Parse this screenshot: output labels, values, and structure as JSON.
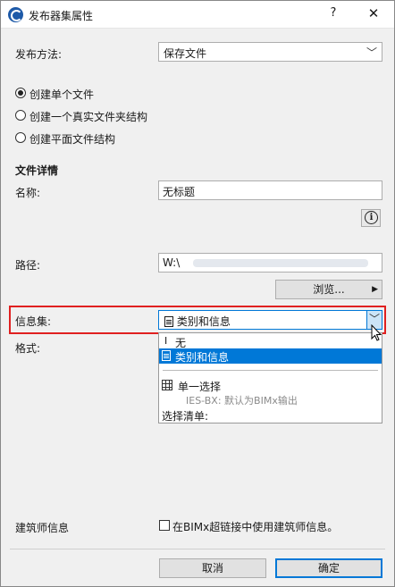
{
  "window": {
    "title": "发布器集属性",
    "help": "?",
    "close": "✕"
  },
  "publish_method": {
    "label": "发布方法:",
    "value": "保存文件"
  },
  "radios": [
    {
      "label": "创建单个文件",
      "checked": true
    },
    {
      "label": "创建一个真实文件夹结构",
      "checked": false
    },
    {
      "label": "创建平面文件结构",
      "checked": false
    }
  ],
  "file_details": {
    "heading": "文件详情",
    "name_label": "名称:",
    "name_value": "无标题",
    "path_label": "路径:",
    "path_value": "W:\\",
    "browse_label": "浏览..."
  },
  "info_set": {
    "label": "信息集:",
    "value": "类别和信息",
    "options": [
      {
        "label": "无",
        "selected": false
      },
      {
        "label": "类别和信息",
        "selected": true
      }
    ],
    "single_select_label": "单一选择",
    "single_select_note": "IES-BX: 默认为BIMx输出",
    "list_label": "选择清单:"
  },
  "format": {
    "label": "格式:"
  },
  "architect_info": {
    "label": "建筑师信息",
    "checkbox_label": "在BIMx超链接中使用建筑师信息。",
    "checked": false
  },
  "buttons": {
    "cancel": "取消",
    "ok": "确定"
  },
  "colors": {
    "accent": "#0078d7",
    "highlight": "#e02020"
  }
}
